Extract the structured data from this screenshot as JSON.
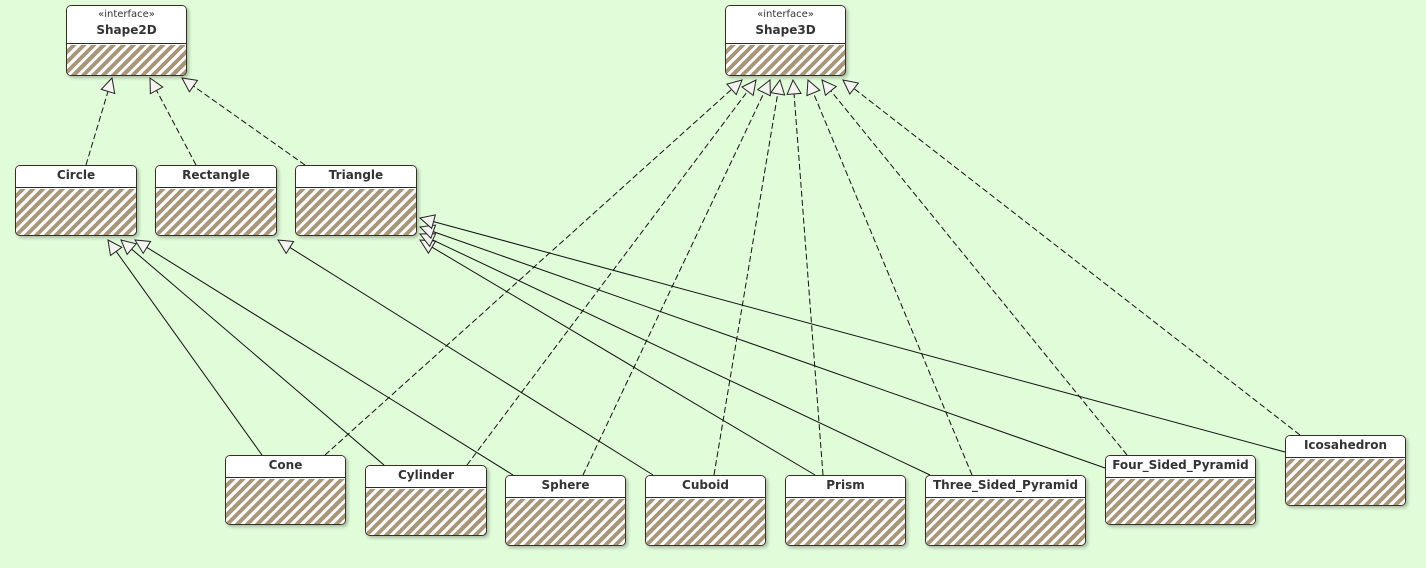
{
  "colors": {
    "background": "#e0fcd9",
    "hatch": "#a8967a",
    "border": "#3a2e24"
  },
  "classes": [
    {
      "id": "Shape2D",
      "name": "Shape2D",
      "stereotype": "«interface»"
    },
    {
      "id": "Shape3D",
      "name": "Shape3D",
      "stereotype": "«interface»"
    },
    {
      "id": "Circle",
      "name": "Circle"
    },
    {
      "id": "Rectangle",
      "name": "Rectangle"
    },
    {
      "id": "Triangle",
      "name": "Triangle"
    },
    {
      "id": "Cone",
      "name": "Cone"
    },
    {
      "id": "Cylinder",
      "name": "Cylinder"
    },
    {
      "id": "Sphere",
      "name": "Sphere"
    },
    {
      "id": "Cuboid",
      "name": "Cuboid"
    },
    {
      "id": "Prism",
      "name": "Prism"
    },
    {
      "id": "Three_Sided_Pyramid",
      "name": "Three_Sided_Pyramid"
    },
    {
      "id": "Four_Sided_Pyramid",
      "name": "Four_Sided_Pyramid"
    },
    {
      "id": "Icosahedron",
      "name": "Icosahedron"
    }
  ],
  "relations": [
    {
      "from": "Circle",
      "to": "Shape2D",
      "type": "implements"
    },
    {
      "from": "Rectangle",
      "to": "Shape2D",
      "type": "implements"
    },
    {
      "from": "Triangle",
      "to": "Shape2D",
      "type": "implements"
    },
    {
      "from": "Cone",
      "to": "Shape3D",
      "type": "implements"
    },
    {
      "from": "Cylinder",
      "to": "Shape3D",
      "type": "implements"
    },
    {
      "from": "Sphere",
      "to": "Shape3D",
      "type": "implements"
    },
    {
      "from": "Cuboid",
      "to": "Shape3D",
      "type": "implements"
    },
    {
      "from": "Prism",
      "to": "Shape3D",
      "type": "implements"
    },
    {
      "from": "Three_Sided_Pyramid",
      "to": "Shape3D",
      "type": "implements"
    },
    {
      "from": "Four_Sided_Pyramid",
      "to": "Shape3D",
      "type": "implements"
    },
    {
      "from": "Icosahedron",
      "to": "Shape3D",
      "type": "implements"
    },
    {
      "from": "Cone",
      "to": "Circle",
      "type": "extends"
    },
    {
      "from": "Cylinder",
      "to": "Circle",
      "type": "extends"
    },
    {
      "from": "Sphere",
      "to": "Circle",
      "type": "extends"
    },
    {
      "from": "Cuboid",
      "to": "Rectangle",
      "type": "extends"
    },
    {
      "from": "Prism",
      "to": "Triangle",
      "type": "extends"
    },
    {
      "from": "Three_Sided_Pyramid",
      "to": "Triangle",
      "type": "extends"
    },
    {
      "from": "Four_Sided_Pyramid",
      "to": "Triangle",
      "type": "extends"
    },
    {
      "from": "Icosahedron",
      "to": "Triangle",
      "type": "extends"
    }
  ]
}
